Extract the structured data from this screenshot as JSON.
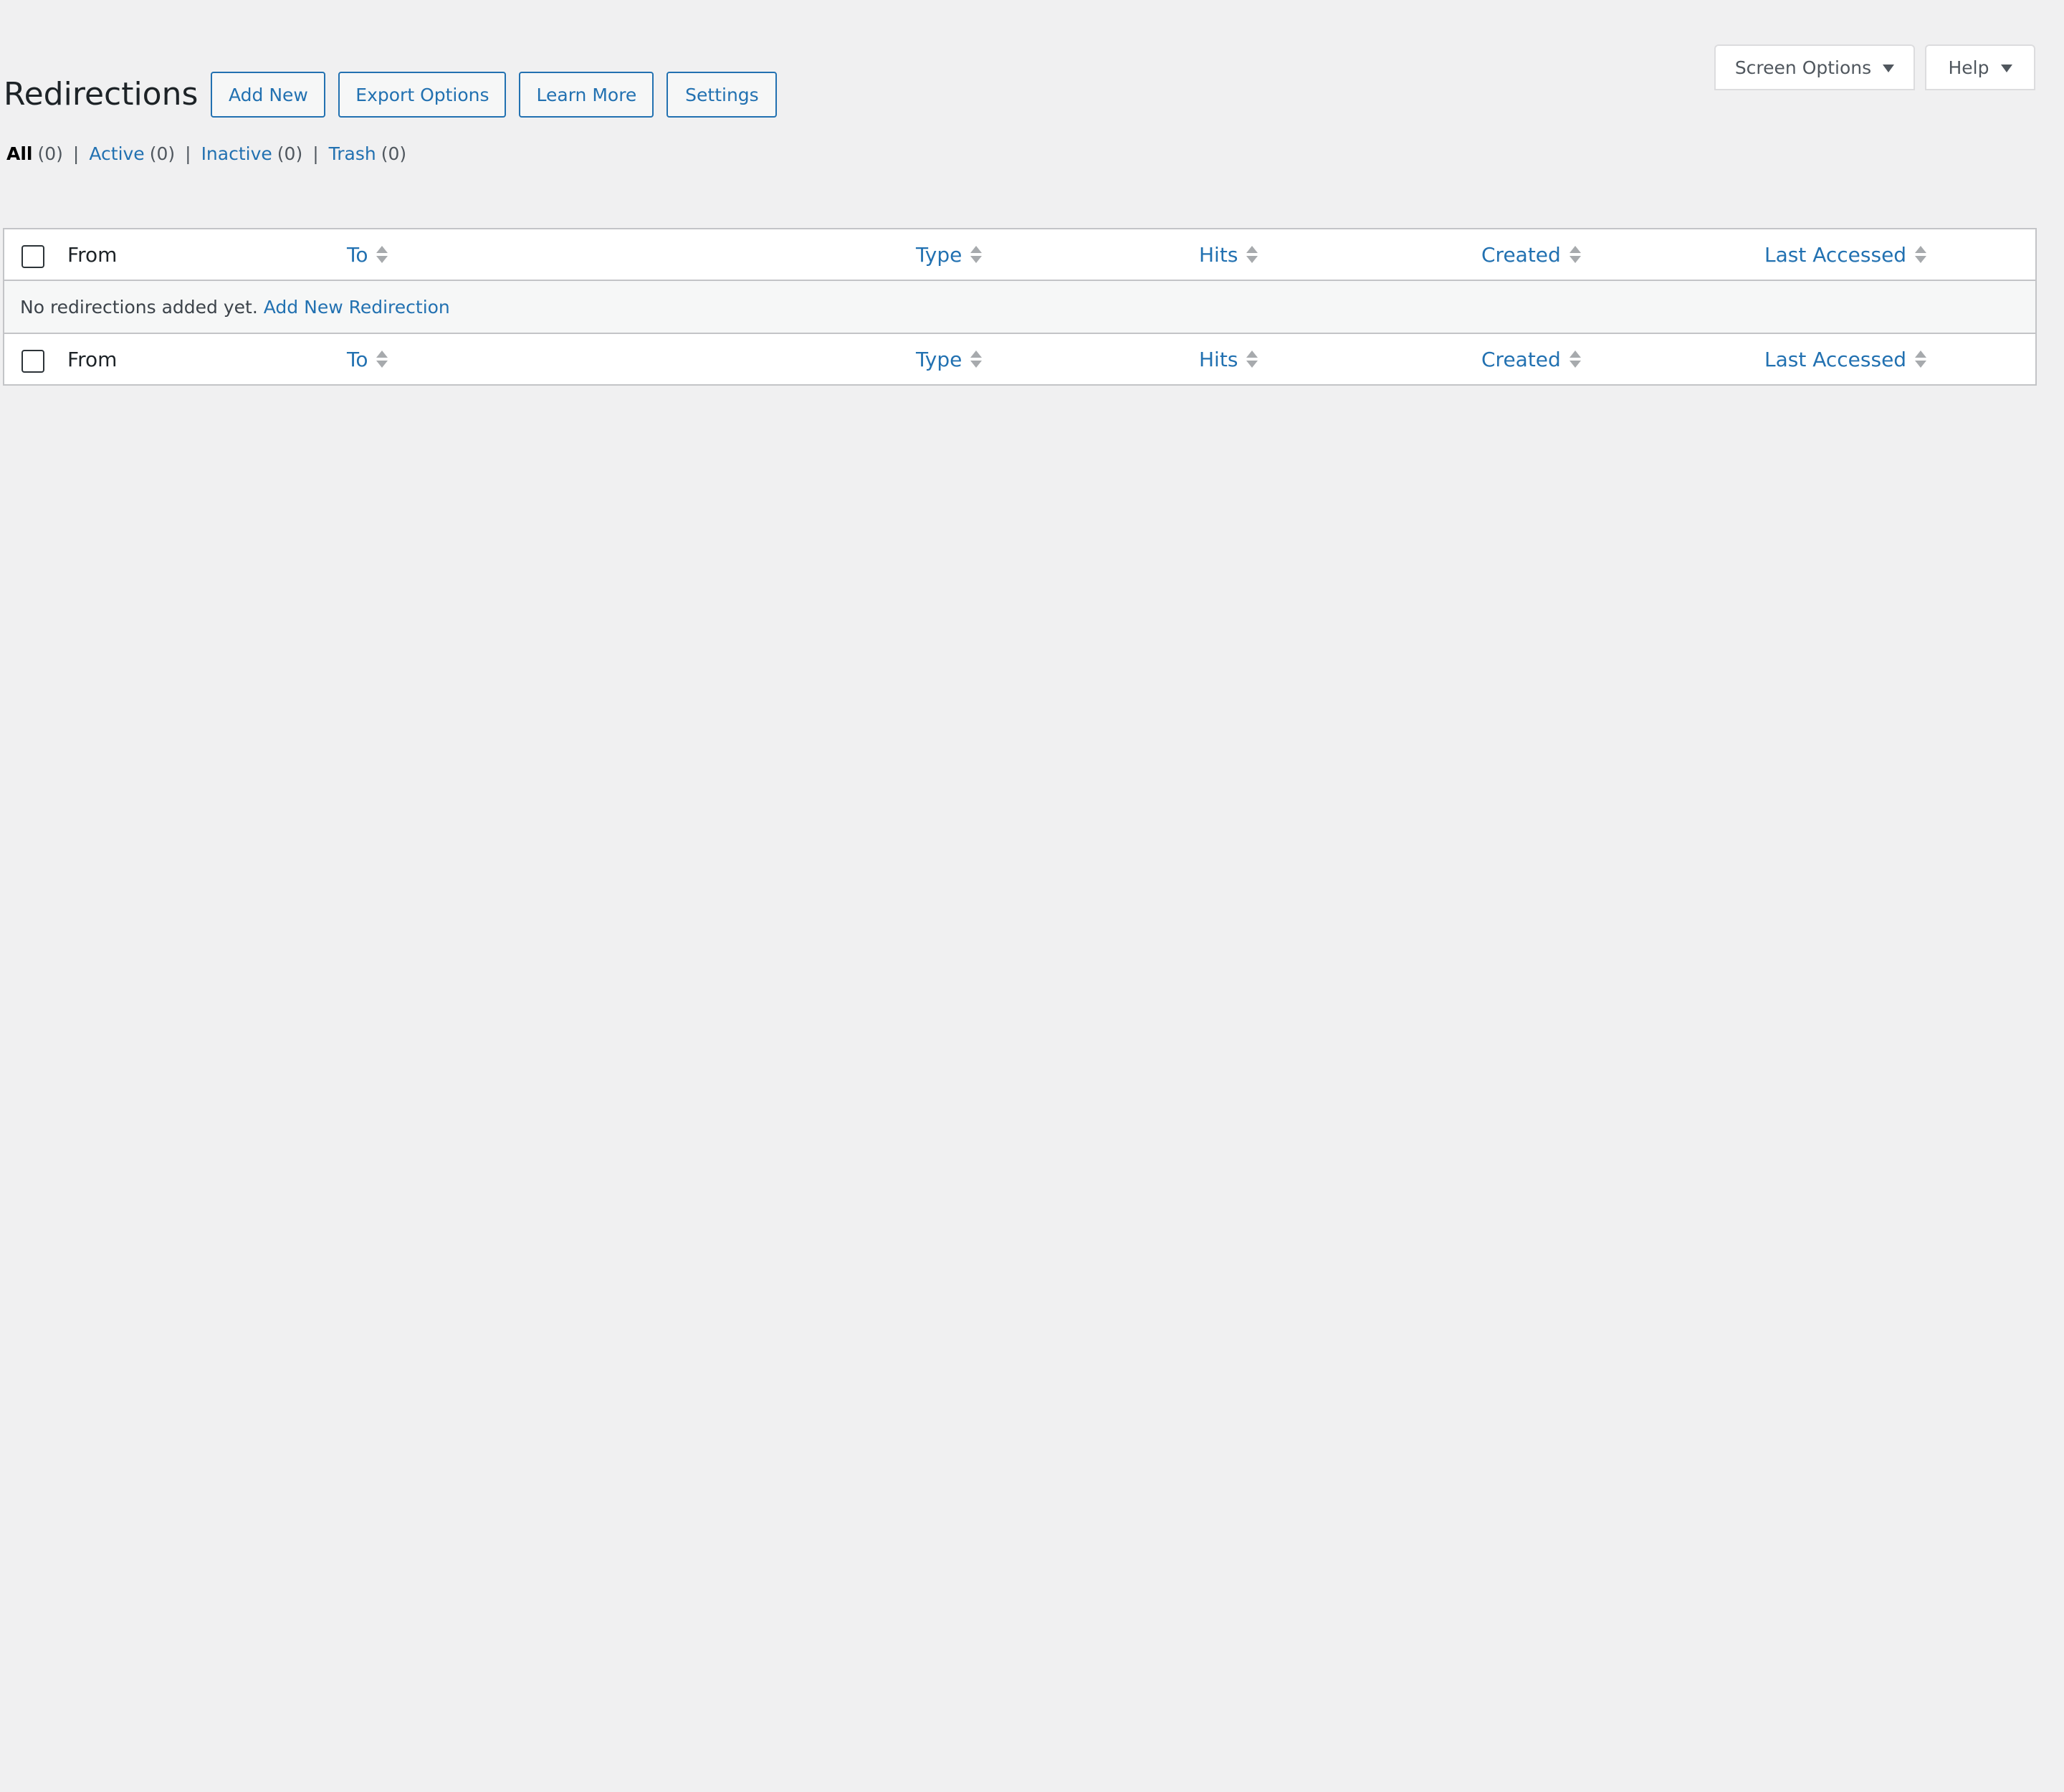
{
  "screen_meta": {
    "screen_options_label": "Screen Options",
    "help_label": "Help"
  },
  "header": {
    "title": "Redirections",
    "actions": {
      "add_new": "Add New",
      "export_options": "Export Options",
      "learn_more": "Learn More",
      "settings": "Settings"
    }
  },
  "filters": [
    {
      "label": "All",
      "count": "(0)",
      "current": true
    },
    {
      "label": "Active",
      "count": "(0)",
      "current": false
    },
    {
      "label": "Inactive",
      "count": "(0)",
      "current": false
    },
    {
      "label": "Trash",
      "count": "(0)",
      "current": false
    }
  ],
  "table": {
    "columns": {
      "from": "From",
      "to": "To",
      "type": "Type",
      "hits": "Hits",
      "created": "Created",
      "last_accessed": "Last Accessed"
    },
    "empty_message": "No redirections added yet.",
    "empty_link": "Add New Redirection"
  },
  "colors": {
    "accent": "#2271b1",
    "background": "#f0f0f1",
    "border": "#c3c4c7"
  }
}
